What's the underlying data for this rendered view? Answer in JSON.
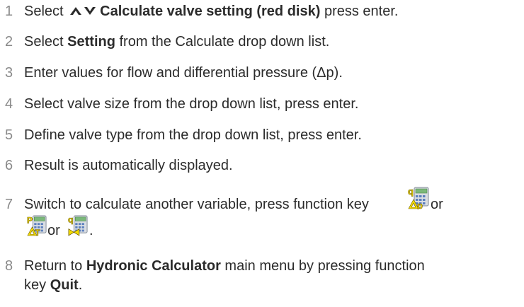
{
  "steps": [
    {
      "num": "1",
      "pre": "Select ",
      "bold": "Calculate valve setting (red disk)",
      "post": " press enter."
    },
    {
      "num": "2",
      "pre": "Select ",
      "bold": "Setting",
      "post": " from the Calculate drop down list."
    },
    {
      "num": "3",
      "text": "Enter values for flow and differential pressure (Δp)."
    },
    {
      "num": "4",
      "text": "Select valve size from the drop down list, press enter."
    },
    {
      "num": "5",
      "text": "Define valve type from the drop down list, press enter."
    },
    {
      "num": "6",
      "text": "Result is automatically displayed."
    },
    {
      "num": "7",
      "text": "Switch to calculate another variable, press function key",
      "or1": " or",
      "or2": "or",
      "end": "."
    },
    {
      "num": "8",
      "pre": "Return to ",
      "bold": "Hydronic Calculator",
      "post": " main menu by pressing function",
      "line2_pre": "key ",
      "line2_bold": "Quit",
      "line2_post": "."
    }
  ],
  "icons": {
    "arrows": "up-down-arrows-icon",
    "calc_q_dp": "calculator-q-delta-p-icon",
    "calc_p_dt": "calculator-p-delta-t-icon",
    "calc_q_valve": "calculator-q-valve-icon"
  },
  "colors": {
    "text": "#2b2b2b",
    "number": "#8a8a8a",
    "icon_yellow": "#f5dd00",
    "icon_green": "#7bb87a"
  }
}
